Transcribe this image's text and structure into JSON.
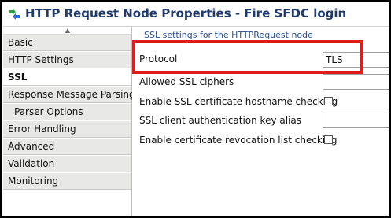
{
  "window": {
    "title": "HTTP Request Node Properties - Fire SFDC login",
    "icon": "node-properties-icon"
  },
  "sidebar": {
    "items": [
      {
        "label": "Basic"
      },
      {
        "label": "HTTP Settings"
      },
      {
        "label": "SSL"
      },
      {
        "label": "Response Message Parsing"
      },
      {
        "label": "Parser Options"
      },
      {
        "label": "Error Handling"
      },
      {
        "label": "Advanced"
      },
      {
        "label": "Validation"
      },
      {
        "label": "Monitoring"
      }
    ],
    "selected": "SSL",
    "scroll_up_glyph": "▲"
  },
  "main": {
    "section_title": "SSL settings for the HTTPRequest node",
    "fields": {
      "protocol": {
        "label": "Protocol",
        "value": "TLS"
      },
      "allowed_ciphers": {
        "label": "Allowed SSL ciphers",
        "value": ""
      },
      "hostname_check": {
        "label": "Enable SSL certificate hostname checking",
        "checked": false
      },
      "key_alias": {
        "label": "SSL client authentication key alias",
        "value": ""
      },
      "revocation_check": {
        "label": "Enable certificate revocation list checking",
        "checked": false
      }
    }
  },
  "colors": {
    "title_text": "#1f3a6b",
    "highlight_box": "#e01b1b",
    "section_header": "#2a4d8f",
    "nav_background": "#e8e8e6"
  }
}
